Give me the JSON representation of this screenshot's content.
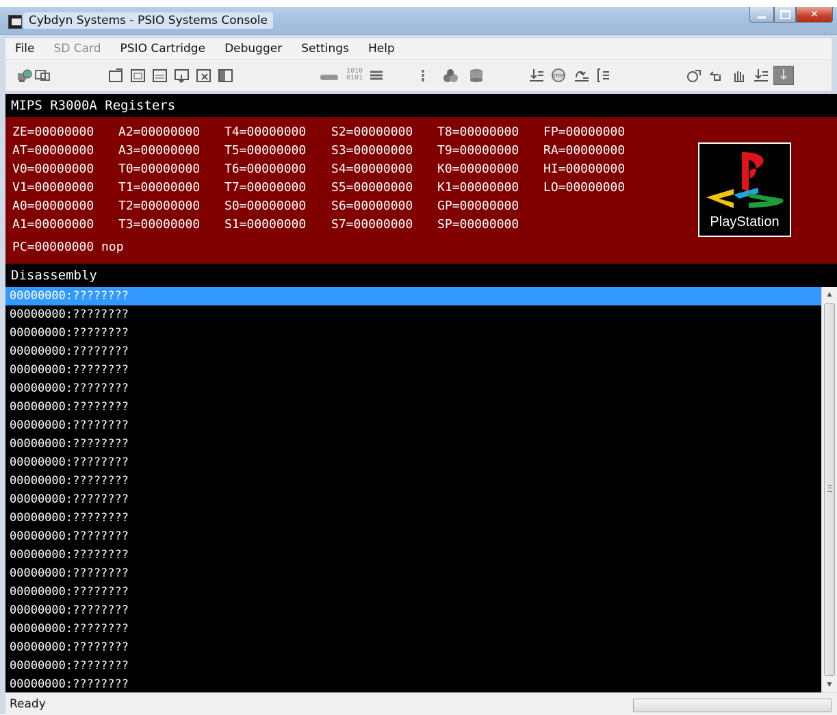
{
  "window": {
    "title": "Cybdyn Systems - PSIO Systems Console"
  },
  "menu": [
    {
      "label": "File",
      "enabled": true
    },
    {
      "label": "SD Card",
      "enabled": false
    },
    {
      "label": "PSIO Cartridge",
      "enabled": true
    },
    {
      "label": "Debugger",
      "enabled": true
    },
    {
      "label": "Settings",
      "enabled": true
    },
    {
      "label": "Help",
      "enabled": true
    }
  ],
  "toolbar": {
    "icons": [
      "connect-icon",
      "disconnect-icon",
      "open-window-icon",
      "memory-window-icon",
      "vram-window-icon",
      "screenshot-icon",
      "close-window-icon",
      "window-layout-icon",
      "binary-view-icon",
      "hex-format-icon",
      "list-icon",
      "column-icon",
      "breakpoint-cubes-icon",
      "database-icon",
      "step-into-icon",
      "stop-icon",
      "step-over-icon",
      "step-out-icon",
      "run-to-cursor-icon",
      "pointer-icon",
      "hand-icon",
      "step-line-icon",
      "pause-icon"
    ]
  },
  "registers": {
    "heading": "MIPS R3000A Registers",
    "rows": [
      [
        "ZE=00000000",
        "A2=00000000",
        "T4=00000000",
        "S2=00000000",
        "T8=00000000",
        "FP=00000000"
      ],
      [
        "AT=00000000",
        "A3=00000000",
        "T5=00000000",
        "S3=00000000",
        "T9=00000000",
        "RA=00000000"
      ],
      [
        "V0=00000000",
        "T0=00000000",
        "T6=00000000",
        "S4=00000000",
        "K0=00000000",
        "HI=00000000"
      ],
      [
        "V1=00000000",
        "T1=00000000",
        "T7=00000000",
        "S5=00000000",
        "K1=00000000",
        "LO=00000000"
      ],
      [
        "A0=00000000",
        "T2=00000000",
        "S0=00000000",
        "S6=00000000",
        "GP=00000000",
        ""
      ],
      [
        "A1=00000000",
        "T3=00000000",
        "S1=00000000",
        "S7=00000000",
        "SP=00000000",
        ""
      ]
    ],
    "pc": "PC=00000000 nop",
    "logo_text": "PlayStation"
  },
  "disassembly": {
    "heading": "Disassembly",
    "selected_index": 0,
    "lines": [
      "00000000:????????",
      "00000000:????????",
      "00000000:????????",
      "00000000:????????",
      "00000000:????????",
      "00000000:????????",
      "00000000:????????",
      "00000000:????????",
      "00000000:????????",
      "00000000:????????",
      "00000000:????????",
      "00000000:????????",
      "00000000:????????",
      "00000000:????????",
      "00000000:????????",
      "00000000:????????",
      "00000000:????????",
      "00000000:????????",
      "00000000:????????",
      "00000000:????????",
      "00000000:????????",
      "00000000:????????"
    ]
  },
  "status": {
    "text": "Ready",
    "progress": 0
  },
  "colors": {
    "register_bg": "#800000",
    "selection": "#3399ff",
    "console_bg": "#000000"
  }
}
